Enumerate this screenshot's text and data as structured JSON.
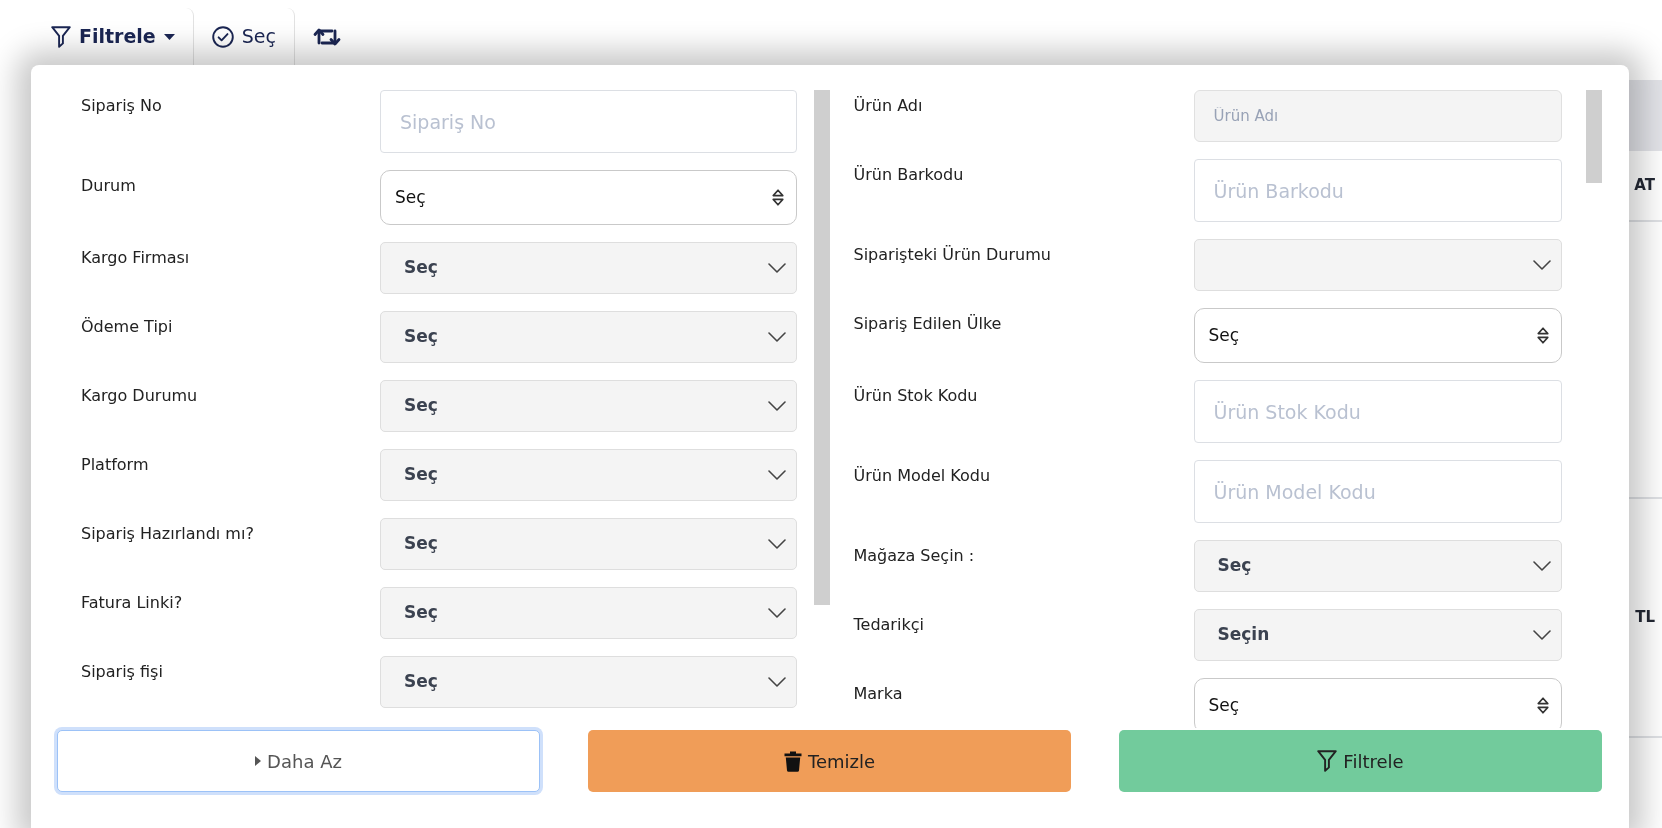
{
  "toolbar": [
    {
      "kind": "dropdown",
      "label": "Filtrele"
    },
    {
      "kind": "select",
      "label": "Seç"
    },
    {
      "kind": "refresh"
    }
  ],
  "background_table": {
    "header_fragment": "AT",
    "cell_fragment": "TL"
  },
  "filters": {
    "left": [
      {
        "label": "Sipariş No",
        "kind": "input",
        "placeholder": "Sipariş No"
      },
      {
        "label": "Durum",
        "kind": "native",
        "value": "Seç"
      },
      {
        "label": "Kargo Firması",
        "kind": "select",
        "value": "Seç"
      },
      {
        "label": "Ödeme Tipi",
        "kind": "select",
        "value": "Seç"
      },
      {
        "label": "Kargo Durumu",
        "kind": "select",
        "value": "Seç"
      },
      {
        "label": "Platform",
        "kind": "select",
        "value": "Seç"
      },
      {
        "label": "Sipariş Hazırlandı mı?",
        "kind": "select",
        "value": "Seç"
      },
      {
        "label": "Fatura Linki?",
        "kind": "select",
        "value": "Seç"
      },
      {
        "label": "Sipariş fişi",
        "kind": "select",
        "value": "Seç"
      }
    ],
    "right": [
      {
        "label": "Ürün Adı",
        "kind": "shaded",
        "placeholder": "Ürün Adı"
      },
      {
        "label": "Ürün Barkodu",
        "kind": "input",
        "placeholder": "Ürün Barkodu"
      },
      {
        "label": "Siparişteki Ürün Durumu",
        "kind": "select"
      },
      {
        "label": "Sipariş Edilen Ülke",
        "kind": "native",
        "value": "Seç"
      },
      {
        "label": "Ürün Stok Kodu",
        "kind": "input",
        "placeholder": "Ürün Stok Kodu"
      },
      {
        "label": "Ürün Model Kodu",
        "kind": "input",
        "placeholder": "Ürün Model Kodu"
      },
      {
        "label": "Mağaza Seçin :",
        "kind": "select",
        "value": "Seç"
      },
      {
        "label": "Tedarikçi",
        "kind": "select",
        "value": "Seçin"
      },
      {
        "label": "Marka",
        "kind": "native",
        "value": "Seç"
      }
    ]
  },
  "actions": [
    {
      "kind": "toggle",
      "label": "Daha Az",
      "focused": true
    },
    {
      "kind": "clear",
      "label": "Temizle",
      "focused": false
    },
    {
      "kind": "apply",
      "label": "Filtrele",
      "focused": false
    }
  ]
}
